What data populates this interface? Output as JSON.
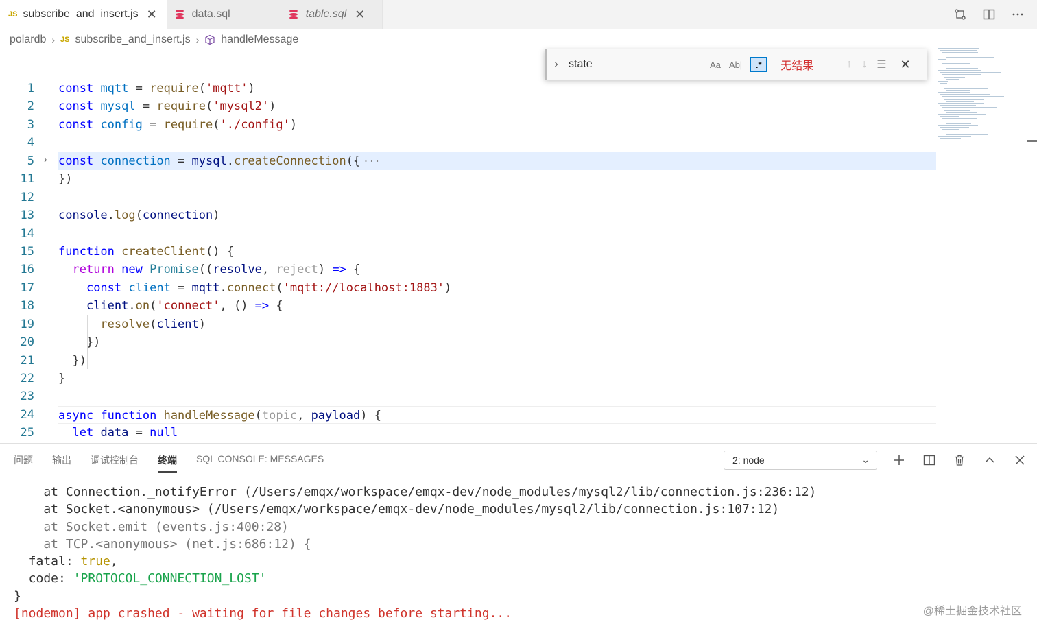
{
  "tabs": [
    {
      "icon": "JS",
      "label": "subscribe_and_insert.js",
      "close": "✕"
    },
    {
      "label": "data.sql"
    },
    {
      "label": "table.sql",
      "close": "✕"
    }
  ],
  "breadcrumb": {
    "root": "polardb",
    "file_icon": "JS",
    "file": "subscribe_and_insert.js",
    "symbol": "handleMessage"
  },
  "editor": {
    "line_numbers": [
      "1",
      "2",
      "3",
      "4",
      "5",
      "11",
      "12",
      "13",
      "14",
      "15",
      "16",
      "17",
      "18",
      "19",
      "20",
      "21",
      "22",
      "23",
      "24",
      "25"
    ],
    "folded_marker": "···"
  },
  "find": {
    "query": "state",
    "match_case": "Aa",
    "whole_word": "Ab|",
    "regex": ".*",
    "result": "无结果"
  },
  "panel": {
    "tabs": [
      "问题",
      "输出",
      "调试控制台",
      "终端",
      "SQL CONSOLE: MESSAGES"
    ],
    "active_tab": "终端",
    "terminal_selector": "2: node"
  },
  "terminal": {
    "l1": "    at Connection._notifyError (/Users/emqx/workspace/emqx-dev/node_modules/mysql2/lib/connection.js:236:12)",
    "l2_a": "    at Socket.<anonymous> (/Users/emqx/workspace/emqx-dev/node_modules/",
    "l2_b": "mysql2",
    "l2_c": "/lib/connection.js:107:12)",
    "l3": "    at Socket.emit (events.js:400:28)",
    "l4": "    at TCP.<anonymous> (net.js:686:12) {",
    "l5_key": "  fatal: ",
    "l5_val": "true",
    "l5_end": ",",
    "l6_key": "  code: ",
    "l6_val": "'PROTOCOL_CONNECTION_LOST'",
    "l7": "}",
    "l8": "[nodemon] app crashed - waiting for file changes before starting..."
  },
  "watermark": "@稀土掘金技术社区"
}
